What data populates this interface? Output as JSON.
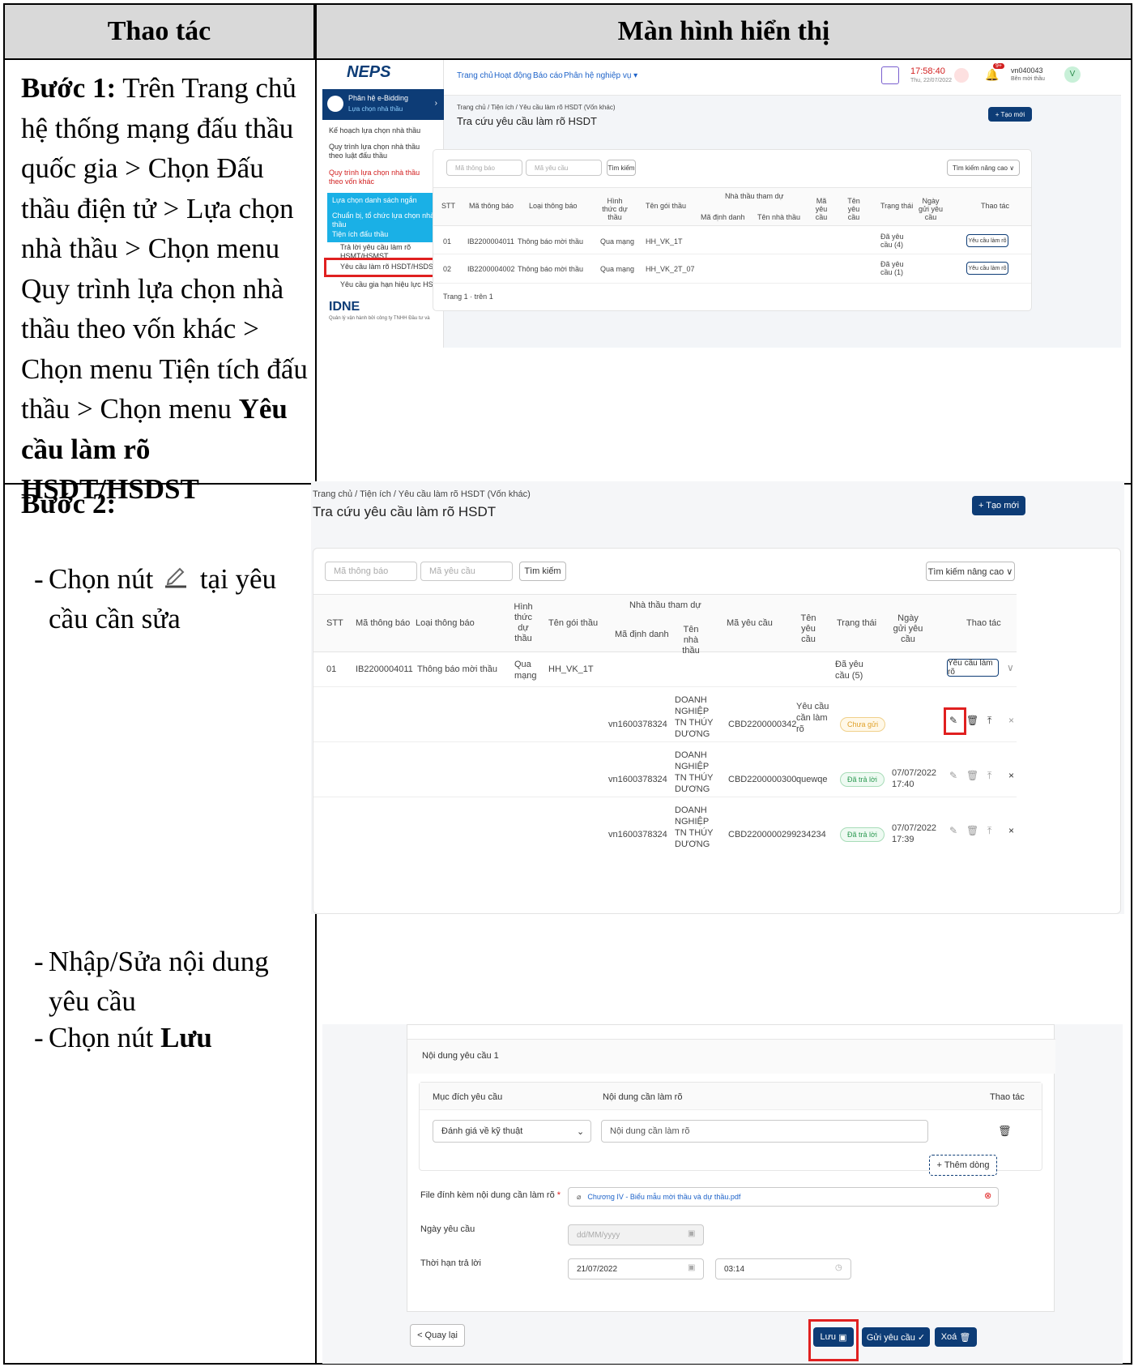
{
  "header": {
    "col1": "Thao tác",
    "col2": "Màn hình hiển thị"
  },
  "step1": {
    "label": "Bước 1:",
    "text": "Trên Trang chủ hệ thống mạng đấu thầu quốc gia > Chọn Đấu thầu điện tử > Lựa chọn nhà thầu > Chọn menu Quy trình lựa chọn nhà thầu theo vốn khác > Chọn menu Tiện tích đấu thầu > Chọn menu ",
    "bold": "Yêu cầu làm rõ HSDT/HSDST"
  },
  "step2": {
    "label": "Bước 2:",
    "b1_pre": "Chọn nút",
    "b1_post": "tại yêu cầu cần sửa",
    "b2": "Nhập/Sửa nội dung yêu cầu",
    "b3_pre": "Chọn nút ",
    "b3_bold": "Lưu"
  },
  "shot1": {
    "logo": "NEPS",
    "nav": [
      "Trang chủ",
      "Hoạt động",
      "Báo cáo",
      "Phân hệ nghiệp vụ ▾"
    ],
    "clock": "17:58:40",
    "date": "Thu, 22/07/2022",
    "user": "vn040043",
    "role": "Bên mời thầu",
    "avatar": "V",
    "badge": "9+",
    "module_title": "Phân hệ e-Bidding",
    "module_sub": "Lựa chọn nhà thầu",
    "side": [
      "Kế hoạch lựa chọn nhà thầu",
      "Quy trình lựa chọn nhà thầu theo luật đấu thầu",
      "Quy trình lựa chọn nhà thầu theo vốn khác"
    ],
    "side_sel": [
      "Lựa chọn danh sách ngắn",
      "Chuẩn bị, tổ chức lựa chọn nhà thầu",
      "Tiện ích đấu thầu"
    ],
    "sub_items": [
      "Trả lời yêu cầu làm rõ HSMT/HSMST",
      "Yêu cầu làm rõ HSDT/HSDST",
      "Yêu cầu gia hạn hiệu lực HSDT"
    ],
    "idne": "IDNE",
    "idne_sub": "Quản lý vận hành bởi công ty TNHH Đầu tư và",
    "breadcrumb": "Trang chủ  /  Tiện ích  /  Yêu cầu làm rõ HSDT (Vốn khác)",
    "title": "Tra cứu yêu cầu làm rõ HSDT",
    "new_btn": "+ Tạo mới",
    "ph_notice": "Mã thông báo",
    "ph_request": "Mã yêu cầu",
    "search": "Tìm kiếm",
    "adv_search": "Tìm kiếm nâng cao ∨",
    "cols": [
      "STT",
      "Mã thông báo",
      "Loại thông báo",
      "Hình thức dự thầu",
      "Tên gói thầu",
      "Nhà thầu tham dự",
      "Mã định danh",
      "Tên nhà thầu",
      "Mã yêu cầu",
      "Tên yêu cầu",
      "Trạng thái",
      "Ngày gửi yêu cầu",
      "Thao tác"
    ],
    "rows": [
      {
        "stt": "01",
        "code": "IB2200004011",
        "type": "Thông báo mời thầu",
        "form": "Qua mạng",
        "pkg": "HH_VK_1T",
        "status": "Đã yêu cầu (4)",
        "action": "Yêu cầu làm rõ"
      },
      {
        "stt": "02",
        "code": "IB2200004002",
        "type": "Thông báo mời thầu",
        "form": "Qua mạng",
        "pkg": "HH_VK_2T_07",
        "status": "Đã yêu cầu (1)",
        "action": "Yêu cầu làm rõ"
      }
    ],
    "pager": "Trang   1   ·   trên 1"
  },
  "shot2": {
    "breadcrumb": "Trang chủ  /  Tiện ích  /  Yêu cầu làm rõ HSDT (Vốn khác)",
    "title": "Tra cứu yêu cầu làm rõ HSDT",
    "new_btn": "+  Tạo mới",
    "ph_notice": "Mã thông báo",
    "ph_request": "Mã yêu cầu",
    "search": "Tìm kiếm",
    "adv_search": "Tìm kiếm nâng cao  ∨",
    "cols": {
      "stt": "STT",
      "code": "Mã thông báo",
      "type": "Loại thông báo",
      "form": "Hình thức dự thầu",
      "pkg": "Tên gói thầu",
      "bidders": "Nhà thầu tham dự",
      "id": "Mã định danh",
      "bname": "Tên nhà thầu",
      "req": "Mã yêu cầu",
      "rname": "Tên yêu cầu",
      "status": "Trạng thái",
      "date": "Ngày gửi yêu cầu",
      "act": "Thao tác"
    },
    "main_row": {
      "stt": "01",
      "code": "IB2200004011",
      "type": "Thông báo mời thầu",
      "form": "Qua mạng",
      "pkg": "HH_VK_1T",
      "status": "Đã yêu cầu (5)",
      "action": "Yêu cầu làm rõ"
    },
    "sub_rows": [
      {
        "id": "vn1600378324",
        "name": "DOANH NGHIỆP TN THÚY DƯƠNG",
        "req": "CBD2200000342",
        "rname": "Yêu cầu cần làm rõ",
        "status": "Chưa gửi",
        "date": ""
      },
      {
        "id": "vn1600378324",
        "name": "DOANH NGHIỆP TN THÚY DƯƠNG",
        "req": "CBD2200000300",
        "rname": "quewqe",
        "status": "Đã trả lời",
        "date": "07/07/2022 17:40"
      },
      {
        "id": "vn1600378324",
        "name": "DOANH NGHIỆP TN THÚY DƯƠNG",
        "req": "CBD2200000299",
        "rname": "234234",
        "status": "Đã trả lời",
        "date": "07/07/2022 17:39"
      }
    ]
  },
  "shot3": {
    "section": "Nội dung yêu cầu 1",
    "col_purpose": "Mục đích yêu cầu",
    "col_content": "Nội dung cần làm rõ",
    "col_action": "Thao tác",
    "purpose_value": "Đánh giá về kỹ thuật",
    "content_ph": "Nội dung cần làm rõ",
    "add_row": "+  Thêm dòng",
    "file_label": "File đính kèm nội dung cần làm rõ",
    "file_value": "Chương IV - Biểu mẫu mời thầu và dự thầu.pdf",
    "date_label": "Ngày yêu cầu",
    "date_ph": "dd/MM/yyyy",
    "deadline_label": "Thời hạn trả lời",
    "deadline_date": "21/07/2022",
    "deadline_time": "03:14",
    "back": "<  Quay lại",
    "save": "Lưu",
    "send": "Gửi yêu cầu ✓",
    "delete": "Xoá"
  },
  "colors": {
    "navy": "#0d3c76",
    "highlight": "#e02020",
    "link": "#1e63c9",
    "header_bg": "#d9d9d9"
  }
}
